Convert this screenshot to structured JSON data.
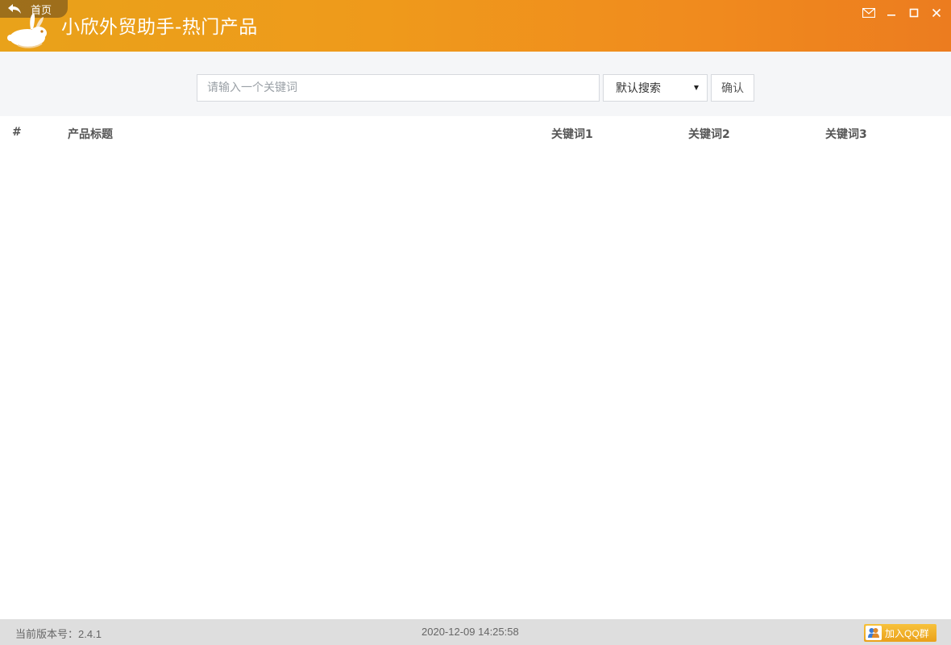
{
  "titlebar": {
    "home_label": "首页",
    "app_title": "小欣外贸助手-热门产品",
    "accent_color": "#ef9a1b"
  },
  "window_controls": [
    {
      "name": "mail-icon"
    },
    {
      "name": "minimize-icon"
    },
    {
      "name": "maximize-icon"
    },
    {
      "name": "close-icon"
    }
  ],
  "search": {
    "placeholder": "请输入一个关键词",
    "value": "",
    "mode_selected": "默认搜索",
    "confirm_label": "确认"
  },
  "table": {
    "columns": [
      "#",
      "产品标题",
      "关键词1",
      "关键词2",
      "关键词3"
    ],
    "rows": []
  },
  "statusbar": {
    "version_label": "当前版本号：",
    "version_value": "2.4.1",
    "datetime": "2020-12-09 14:25:58",
    "qq_label": "加入QQ群"
  }
}
